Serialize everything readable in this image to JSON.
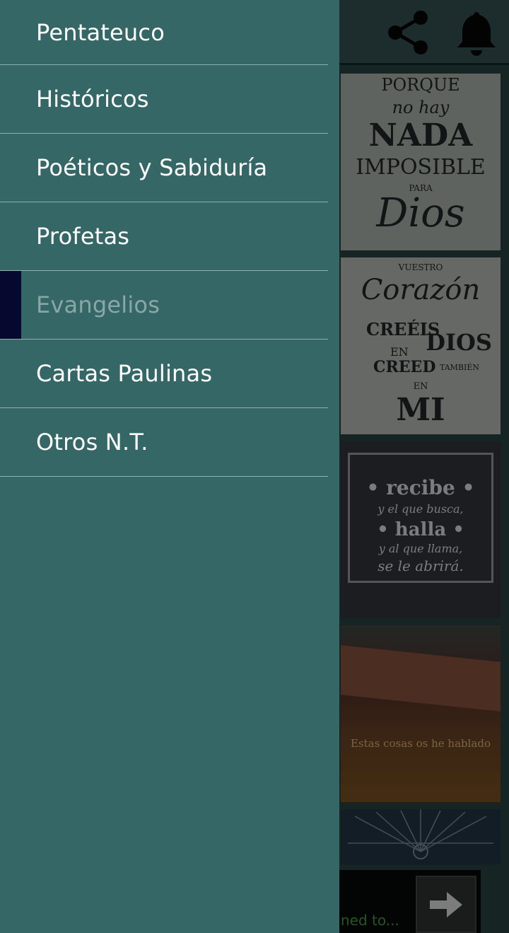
{
  "drawer": {
    "items": [
      {
        "label": "Pentateuco",
        "active": false
      },
      {
        "label": "Históricos",
        "active": false
      },
      {
        "label": "Poéticos y Sabiduría",
        "active": false
      },
      {
        "label": "Profetas",
        "active": false
      },
      {
        "label": "Evangelios",
        "active": true
      },
      {
        "label": "Cartas Paulinas",
        "active": false
      },
      {
        "label": "Otros N.T.",
        "active": false
      }
    ]
  },
  "toolbar": {
    "icons": [
      "share-icon",
      "bell-icon"
    ]
  },
  "feed": {
    "cards": [
      {
        "lines": [
          "PORQUE",
          "no hay",
          "NADA",
          "IMPOSIBLE",
          "PARA",
          "Dios"
        ]
      },
      {
        "lines": [
          "VUESTRO",
          "Corazón",
          "CREÉIS",
          "EN",
          "DIOS",
          "CREED",
          "TAMBIÉN",
          "EN",
          "MI"
        ]
      },
      {
        "lines": [
          "• recibe •",
          "y el que busca,",
          "• halla •",
          "y al que llama,",
          "se le abrirá."
        ]
      },
      {
        "lines": [
          "Estas cosas os he hablado"
        ]
      },
      {
        "lines": []
      }
    ]
  },
  "ad": {
    "text": "ned to..."
  },
  "colors": {
    "drawer_bg": "#356766",
    "active_indicator": "#060830",
    "active_text": "#8aa7a7",
    "text": "#ffffff",
    "ad_text": "#3d8a3d"
  }
}
